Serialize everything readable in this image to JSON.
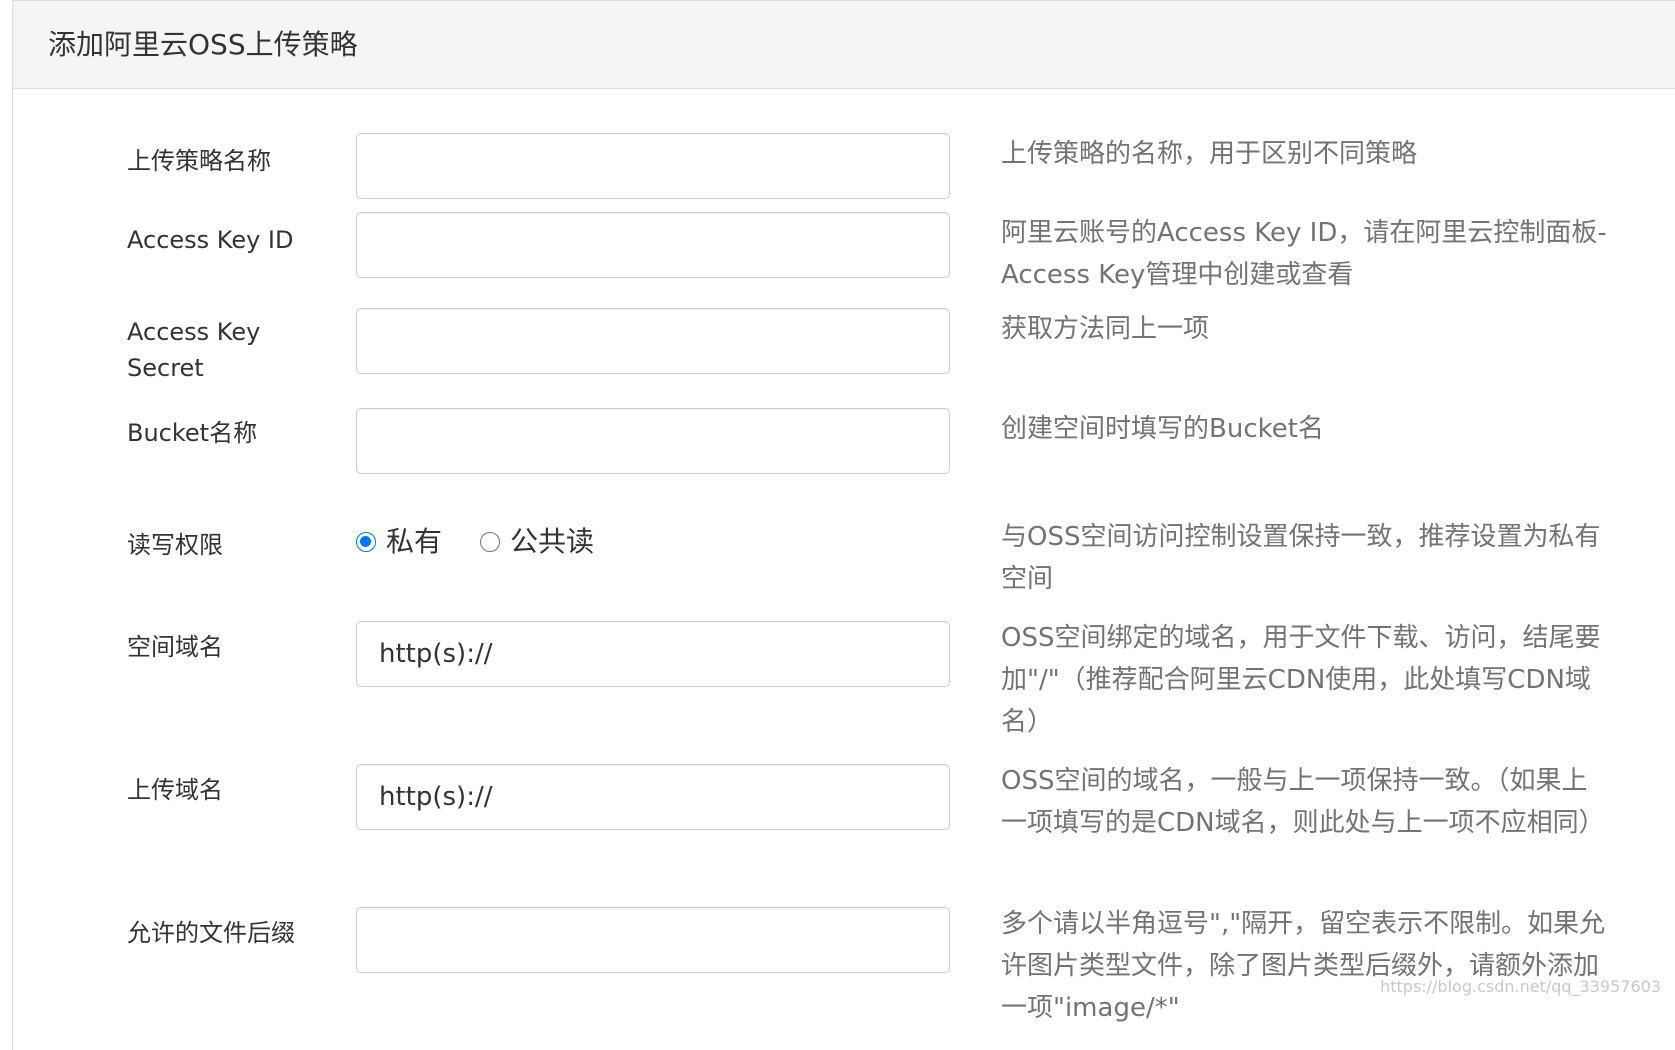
{
  "panel": {
    "title": "添加阿里云OSS上传策略"
  },
  "fields": {
    "policy_name": {
      "label": "上传策略名称",
      "value": "",
      "help": "上传策略的名称，用于区别不同策略"
    },
    "access_key_id": {
      "label": "Access Key ID",
      "value": "",
      "help": "阿里云账号的Access Key ID，请在阿里云控制面板-Access Key管理中创建或查看"
    },
    "access_key_secret": {
      "label": "Access Key Secret",
      "value": "",
      "help": "获取方法同上一项"
    },
    "bucket_name": {
      "label": "Bucket名称",
      "value": "",
      "help": "创建空间时填写的Bucket名"
    },
    "permission": {
      "label": "读写权限",
      "options": [
        {
          "label": "私有",
          "checked": true
        },
        {
          "label": "公共读",
          "checked": false
        }
      ],
      "help": "与OSS空间访问控制设置保持一致，推荐设置为私有空间"
    },
    "space_domain": {
      "label": "空间域名",
      "value": "http(s)://",
      "help": "OSS空间绑定的域名，用于文件下载、访问，结尾要加\"/\"（推荐配合阿里云CDN使用，此处填写CDN域名）"
    },
    "upload_domain": {
      "label": "上传域名",
      "value": "http(s)://",
      "help": "OSS空间的域名，一般与上一项保持一致。（如果上一项填写的是CDN域名，则此处与上一项不应相同）"
    },
    "allowed_suffix": {
      "label": "允许的文件后缀",
      "value": "",
      "help": "多个请以半角逗号\",\"隔开，留空表示不限制。如果允许图片类型文件，除了图片类型后缀外，请额外添加一项\"image/*\""
    }
  },
  "watermark": "https://blog.csdn.net/qq_33957603",
  "colors": {
    "accent": "#0075ff",
    "help_text": "#737373",
    "heading_bg": "#f5f5f5"
  }
}
